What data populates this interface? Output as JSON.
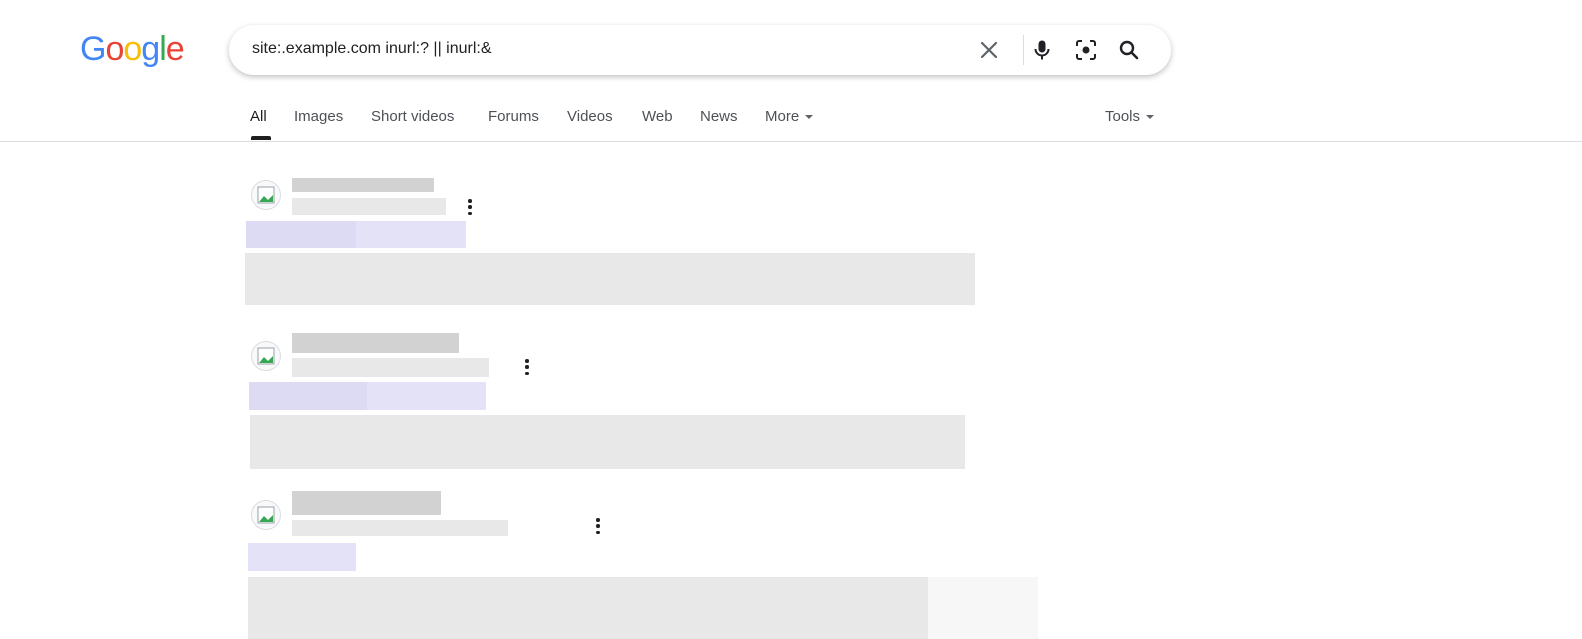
{
  "logo": {
    "letters": [
      "G",
      "o",
      "o",
      "g",
      "l",
      "e"
    ],
    "colors": [
      "#4285F4",
      "#EA4335",
      "#FBBC05",
      "#4285F4",
      "#34A853",
      "#EA4335"
    ]
  },
  "search": {
    "query": "site:.example.com inurl:? || inurl:&",
    "icons": [
      "close-icon",
      "microphone-icon",
      "lens-icon",
      "search-icon"
    ]
  },
  "tabs": [
    {
      "label": "All",
      "active": true
    },
    {
      "label": "Images"
    },
    {
      "label": "Short videos"
    },
    {
      "label": "Forums"
    },
    {
      "label": "Videos"
    },
    {
      "label": "Web"
    },
    {
      "label": "News"
    },
    {
      "label": "More"
    }
  ],
  "tools": {
    "label": "Tools"
  },
  "colors": {
    "tab_active": "#1f1f1f",
    "tab_inactive": "#4d5156",
    "placeholder_gray": "#e8e8e8",
    "placeholder_purple": "#dddbf3"
  },
  "results_count": 3
}
